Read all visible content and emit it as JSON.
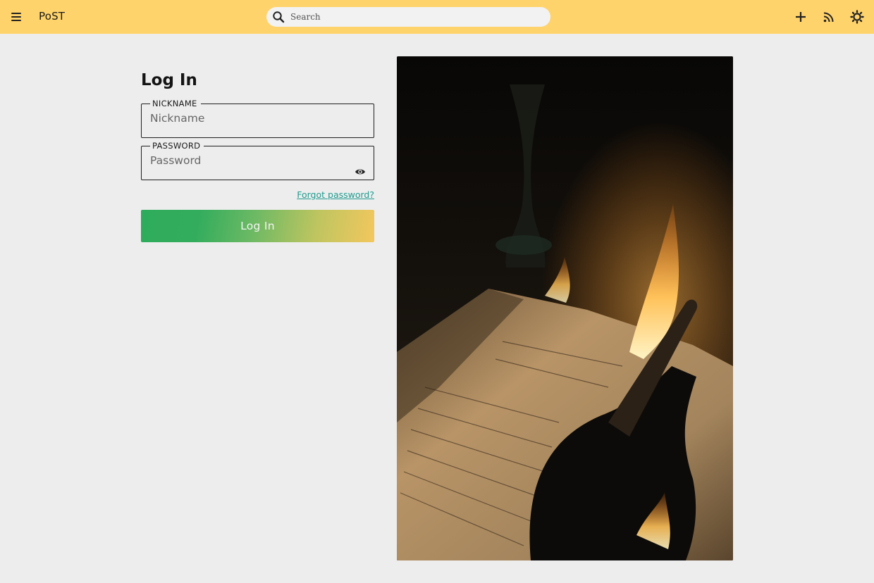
{
  "header": {
    "brand": "PoST",
    "search_placeholder": "Search",
    "icons": [
      "menu-icon",
      "search-icon",
      "plus-icon",
      "rss-icon",
      "sun-icon"
    ]
  },
  "login": {
    "title": "Log In",
    "nickname_label": "NICKNAME",
    "nickname_placeholder": "Nickname",
    "password_label": "PASSWORD",
    "password_placeholder": "Password",
    "forgot_link": "Forgot password?",
    "submit_label": "Log In",
    "show_password_icon": "eye-icon"
  },
  "colors": {
    "header_bg": "#ffd36b",
    "page_bg": "#ededed",
    "link": "#1f9c8f",
    "button_gradient_start": "#2eab5c",
    "button_gradient_end": "#f3c75e"
  }
}
